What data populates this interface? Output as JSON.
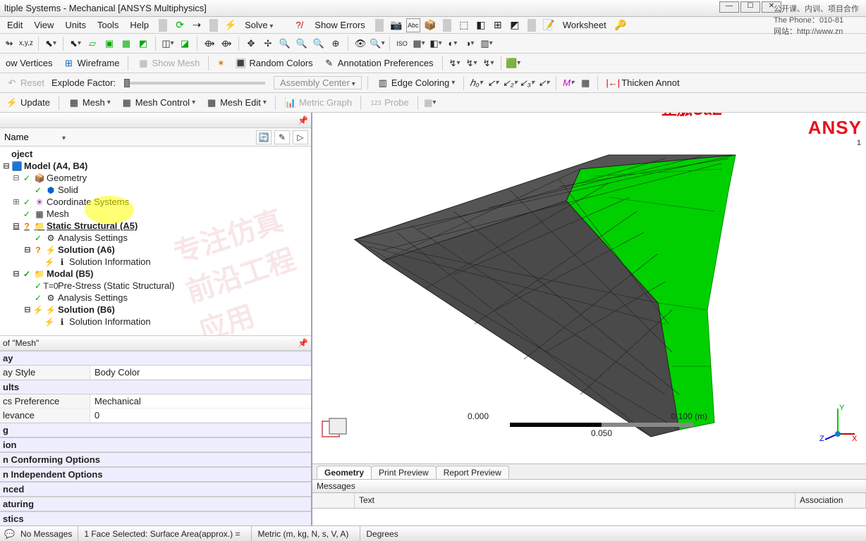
{
  "window": {
    "title": "ltiple Systems - Mechanical [ANSYS Multiphysics]"
  },
  "menu": {
    "edit": "Edit",
    "view": "View",
    "units": "Units",
    "tools": "Tools",
    "help": "Help",
    "solve": "Solve",
    "show_errors": "Show Errors",
    "worksheet": "Worksheet"
  },
  "toolbar2": {
    "show_vertices": "ow Vertices",
    "wireframe": "Wireframe",
    "show_mesh": "Show Mesh",
    "random_colors": "Random Colors",
    "annotation_prefs": "Annotation Preferences"
  },
  "toolbar3": {
    "reset": "Reset",
    "explode_label": "Explode Factor:",
    "assembly_center": "Assembly Center",
    "edge_coloring": "Edge Coloring",
    "thicken": "Thicken Annot"
  },
  "toolbar4": {
    "update": "Update",
    "mesh": "Mesh",
    "mesh_control": "Mesh Control",
    "mesh_edit": "Mesh Edit",
    "metric_graph": "Metric Graph",
    "probe": "Probe"
  },
  "outline": {
    "filter_label": "Name",
    "root": "oject",
    "model": "Model (A4, B4)",
    "geometry": "Geometry",
    "solid": "Solid",
    "coord": "Coordinate Systems",
    "mesh": "Mesh",
    "static": "Static Structural (A5)",
    "analysis1": "Analysis Settings",
    "solution_a": "Solution (A6)",
    "solinfo_a": "Solution Information",
    "modal": "Modal (B5)",
    "prestress": "Pre-Stress (Static Structural)",
    "analysis2": "Analysis Settings",
    "solution_b": "Solution (B6)",
    "solinfo_b": "Solution Information"
  },
  "details": {
    "title": "of \"Mesh\"",
    "cat_display": "ay",
    "display_style_k": "ay Style",
    "display_style_v": "Body Color",
    "cat_defaults": "ults",
    "physics_k": "cs Preference",
    "physics_v": "Mechanical",
    "relevance_k": "levance",
    "relevance_v": "0",
    "cat_sizing": "g",
    "cat_inflation": "ion",
    "cat_patchconf": "n Conforming Options",
    "cat_patchind": "n Independent Options",
    "cat_advanced": "nced",
    "cat_defeat": "aturing",
    "cat_stats": "stics"
  },
  "viewport": {
    "brand": "ANSY",
    "brand_sub": "1",
    "overlay_logo": "正脈CaE",
    "overlay_l1": "公开课、内训、项目合作",
    "overlay_l2": "The Phone：010-81",
    "overlay_l3": "网站：http://www.zn",
    "watermark": "专注仿真前沿工程应用",
    "scale_0": "0.000",
    "scale_mid": "0.050",
    "scale_end": "0.100 (m)",
    "triad_x": "X",
    "triad_y": "Y",
    "triad_z": "Z"
  },
  "tabs": {
    "geometry": "Geometry",
    "print": "Print Preview",
    "report": "Report Preview"
  },
  "messages": {
    "title": "Messages",
    "col_text": "Text",
    "col_assoc": "Association"
  },
  "status": {
    "no_msgs": "No Messages",
    "selection": "1 Face Selected: Surface Area(approx.) =",
    "units": "Metric (m, kg, N, s, V, A)",
    "angle": "Degrees"
  }
}
